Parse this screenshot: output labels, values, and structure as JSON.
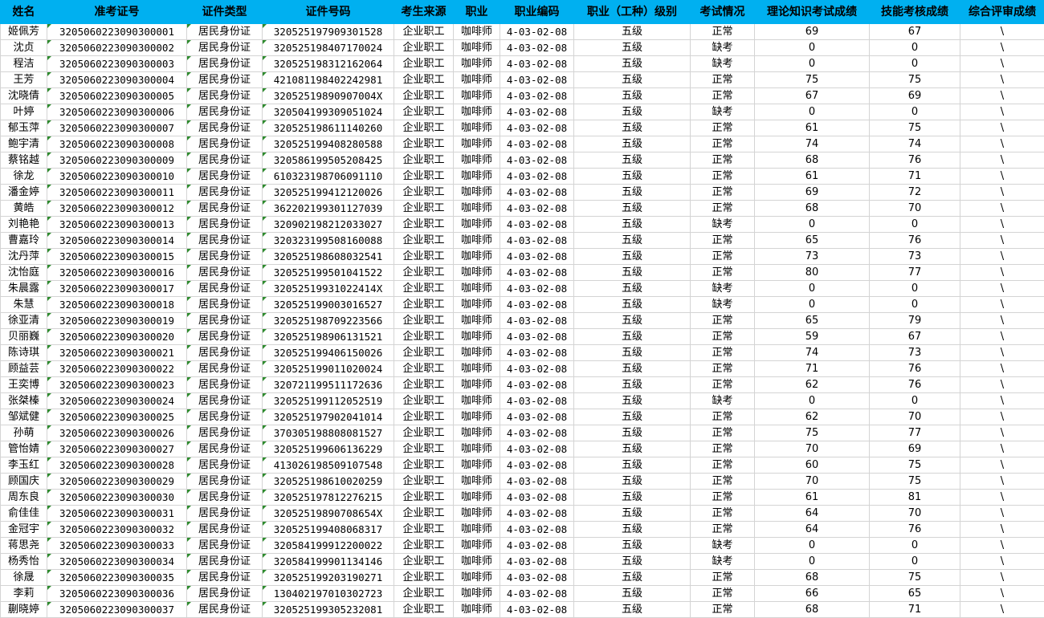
{
  "headers": [
    "姓名",
    "准考证号",
    "证件类型",
    "证件号码",
    "考生来源",
    "职业",
    "职业编码",
    "职业（工种）级别",
    "考试情况",
    "理论知识考试成绩",
    "技能考核成绩",
    "综合评审成绩"
  ],
  "rows": [
    [
      "姬佩芳",
      "3205060223090300001",
      "居民身份证",
      "320525197909301528",
      "企业职工",
      "咖啡师",
      "4-03-02-08",
      "五级",
      "正常",
      "69",
      "67",
      "\\"
    ],
    [
      "沈贞",
      "3205060223090300002",
      "居民身份证",
      "320525198407170024",
      "企业职工",
      "咖啡师",
      "4-03-02-08",
      "五级",
      "缺考",
      "0",
      "0",
      "\\"
    ],
    [
      "程洁",
      "3205060223090300003",
      "居民身份证",
      "320525198312162064",
      "企业职工",
      "咖啡师",
      "4-03-02-08",
      "五级",
      "缺考",
      "0",
      "0",
      "\\"
    ],
    [
      "王芳",
      "3205060223090300004",
      "居民身份证",
      "421081198402242981",
      "企业职工",
      "咖啡师",
      "4-03-02-08",
      "五级",
      "正常",
      "75",
      "75",
      "\\"
    ],
    [
      "沈晓倩",
      "3205060223090300005",
      "居民身份证",
      "32052519890907004X",
      "企业职工",
      "咖啡师",
      "4-03-02-08",
      "五级",
      "正常",
      "67",
      "69",
      "\\"
    ],
    [
      "叶婷",
      "3205060223090300006",
      "居民身份证",
      "320504199309051024",
      "企业职工",
      "咖啡师",
      "4-03-02-08",
      "五级",
      "缺考",
      "0",
      "0",
      "\\"
    ],
    [
      "郁玉萍",
      "3205060223090300007",
      "居民身份证",
      "320525198611140260",
      "企业职工",
      "咖啡师",
      "4-03-02-08",
      "五级",
      "正常",
      "61",
      "75",
      "\\"
    ],
    [
      "鲍宇清",
      "3205060223090300008",
      "居民身份证",
      "320525199408280588",
      "企业职工",
      "咖啡师",
      "4-03-02-08",
      "五级",
      "正常",
      "74",
      "74",
      "\\"
    ],
    [
      "蔡铭越",
      "3205060223090300009",
      "居民身份证",
      "320586199505208425",
      "企业职工",
      "咖啡师",
      "4-03-02-08",
      "五级",
      "正常",
      "68",
      "76",
      "\\"
    ],
    [
      "徐龙",
      "3205060223090300010",
      "居民身份证",
      "610323198706091110",
      "企业职工",
      "咖啡师",
      "4-03-02-08",
      "五级",
      "正常",
      "61",
      "71",
      "\\"
    ],
    [
      "潘金婷",
      "3205060223090300011",
      "居民身份证",
      "320525199412120026",
      "企业职工",
      "咖啡师",
      "4-03-02-08",
      "五级",
      "正常",
      "69",
      "72",
      "\\"
    ],
    [
      "黄皓",
      "3205060223090300012",
      "居民身份证",
      "362202199301127039",
      "企业职工",
      "咖啡师",
      "4-03-02-08",
      "五级",
      "正常",
      "68",
      "70",
      "\\"
    ],
    [
      "刘艳艳",
      "3205060223090300013",
      "居民身份证",
      "320902198212033027",
      "企业职工",
      "咖啡师",
      "4-03-02-08",
      "五级",
      "缺考",
      "0",
      "0",
      "\\"
    ],
    [
      "曹嘉玲",
      "3205060223090300014",
      "居民身份证",
      "320323199508160088",
      "企业职工",
      "咖啡师",
      "4-03-02-08",
      "五级",
      "正常",
      "65",
      "76",
      "\\"
    ],
    [
      "沈丹萍",
      "3205060223090300015",
      "居民身份证",
      "320525198608032541",
      "企业职工",
      "咖啡师",
      "4-03-02-08",
      "五级",
      "正常",
      "73",
      "73",
      "\\"
    ],
    [
      "沈怡庭",
      "3205060223090300016",
      "居民身份证",
      "320525199501041522",
      "企业职工",
      "咖啡师",
      "4-03-02-08",
      "五级",
      "正常",
      "80",
      "77",
      "\\"
    ],
    [
      "朱晨露",
      "3205060223090300017",
      "居民身份证",
      "32052519931022414X",
      "企业职工",
      "咖啡师",
      "4-03-02-08",
      "五级",
      "缺考",
      "0",
      "0",
      "\\"
    ],
    [
      "朱慧",
      "3205060223090300018",
      "居民身份证",
      "320525199003016527",
      "企业职工",
      "咖啡师",
      "4-03-02-08",
      "五级",
      "缺考",
      "0",
      "0",
      "\\"
    ],
    [
      "徐亚清",
      "3205060223090300019",
      "居民身份证",
      "320525198709223566",
      "企业职工",
      "咖啡师",
      "4-03-02-08",
      "五级",
      "正常",
      "65",
      "79",
      "\\"
    ],
    [
      "贝丽巍",
      "3205060223090300020",
      "居民身份证",
      "320525198906131521",
      "企业职工",
      "咖啡师",
      "4-03-02-08",
      "五级",
      "正常",
      "59",
      "67",
      "\\"
    ],
    [
      "陈诗琪",
      "3205060223090300021",
      "居民身份证",
      "320525199406150026",
      "企业职工",
      "咖啡师",
      "4-03-02-08",
      "五级",
      "正常",
      "74",
      "73",
      "\\"
    ],
    [
      "顾益芸",
      "3205060223090300022",
      "居民身份证",
      "320525199011020024",
      "企业职工",
      "咖啡师",
      "4-03-02-08",
      "五级",
      "正常",
      "71",
      "76",
      "\\"
    ],
    [
      "王奕博",
      "3205060223090300023",
      "居民身份证",
      "320721199511172636",
      "企业职工",
      "咖啡师",
      "4-03-02-08",
      "五级",
      "正常",
      "62",
      "76",
      "\\"
    ],
    [
      "张桀榛",
      "3205060223090300024",
      "居民身份证",
      "320525199112052519",
      "企业职工",
      "咖啡师",
      "4-03-02-08",
      "五级",
      "缺考",
      "0",
      "0",
      "\\"
    ],
    [
      "邹斌健",
      "3205060223090300025",
      "居民身份证",
      "320525197902041014",
      "企业职工",
      "咖啡师",
      "4-03-02-08",
      "五级",
      "正常",
      "62",
      "70",
      "\\"
    ],
    [
      "孙萌",
      "3205060223090300026",
      "居民身份证",
      "370305198808081527",
      "企业职工",
      "咖啡师",
      "4-03-02-08",
      "五级",
      "正常",
      "75",
      "77",
      "\\"
    ],
    [
      "管怡婧",
      "3205060223090300027",
      "居民身份证",
      "320525199606136229",
      "企业职工",
      "咖啡师",
      "4-03-02-08",
      "五级",
      "正常",
      "70",
      "69",
      "\\"
    ],
    [
      "李玉红",
      "3205060223090300028",
      "居民身份证",
      "413026198509107548",
      "企业职工",
      "咖啡师",
      "4-03-02-08",
      "五级",
      "正常",
      "60",
      "75",
      "\\"
    ],
    [
      "顾国庆",
      "3205060223090300029",
      "居民身份证",
      "320525198610020259",
      "企业职工",
      "咖啡师",
      "4-03-02-08",
      "五级",
      "正常",
      "70",
      "75",
      "\\"
    ],
    [
      "周东良",
      "3205060223090300030",
      "居民身份证",
      "320525197812276215",
      "企业职工",
      "咖啡师",
      "4-03-02-08",
      "五级",
      "正常",
      "61",
      "81",
      "\\"
    ],
    [
      "俞佳佳",
      "3205060223090300031",
      "居民身份证",
      "32052519890708654X",
      "企业职工",
      "咖啡师",
      "4-03-02-08",
      "五级",
      "正常",
      "64",
      "70",
      "\\"
    ],
    [
      "金冠宇",
      "3205060223090300032",
      "居民身份证",
      "320525199408068317",
      "企业职工",
      "咖啡师",
      "4-03-02-08",
      "五级",
      "正常",
      "64",
      "76",
      "\\"
    ],
    [
      "蒋思尧",
      "3205060223090300033",
      "居民身份证",
      "320584199912200022",
      "企业职工",
      "咖啡师",
      "4-03-02-08",
      "五级",
      "缺考",
      "0",
      "0",
      "\\"
    ],
    [
      "杨秀怡",
      "3205060223090300034",
      "居民身份证",
      "320584199901134146",
      "企业职工",
      "咖啡师",
      "4-03-02-08",
      "五级",
      "缺考",
      "0",
      "0",
      "\\"
    ],
    [
      "徐晟",
      "3205060223090300035",
      "居民身份证",
      "320525199203190271",
      "企业职工",
      "咖啡师",
      "4-03-02-08",
      "五级",
      "正常",
      "68",
      "75",
      "\\"
    ],
    [
      "李莉",
      "3205060223090300036",
      "居民身份证",
      "130402197010302723",
      "企业职工",
      "咖啡师",
      "4-03-02-08",
      "五级",
      "正常",
      "66",
      "65",
      "\\"
    ],
    [
      "蒯晓婷",
      "3205060223090300037",
      "居民身份证",
      "320525199305232081",
      "企业职工",
      "咖啡师",
      "4-03-02-08",
      "五级",
      "正常",
      "68",
      "71",
      "\\"
    ]
  ]
}
